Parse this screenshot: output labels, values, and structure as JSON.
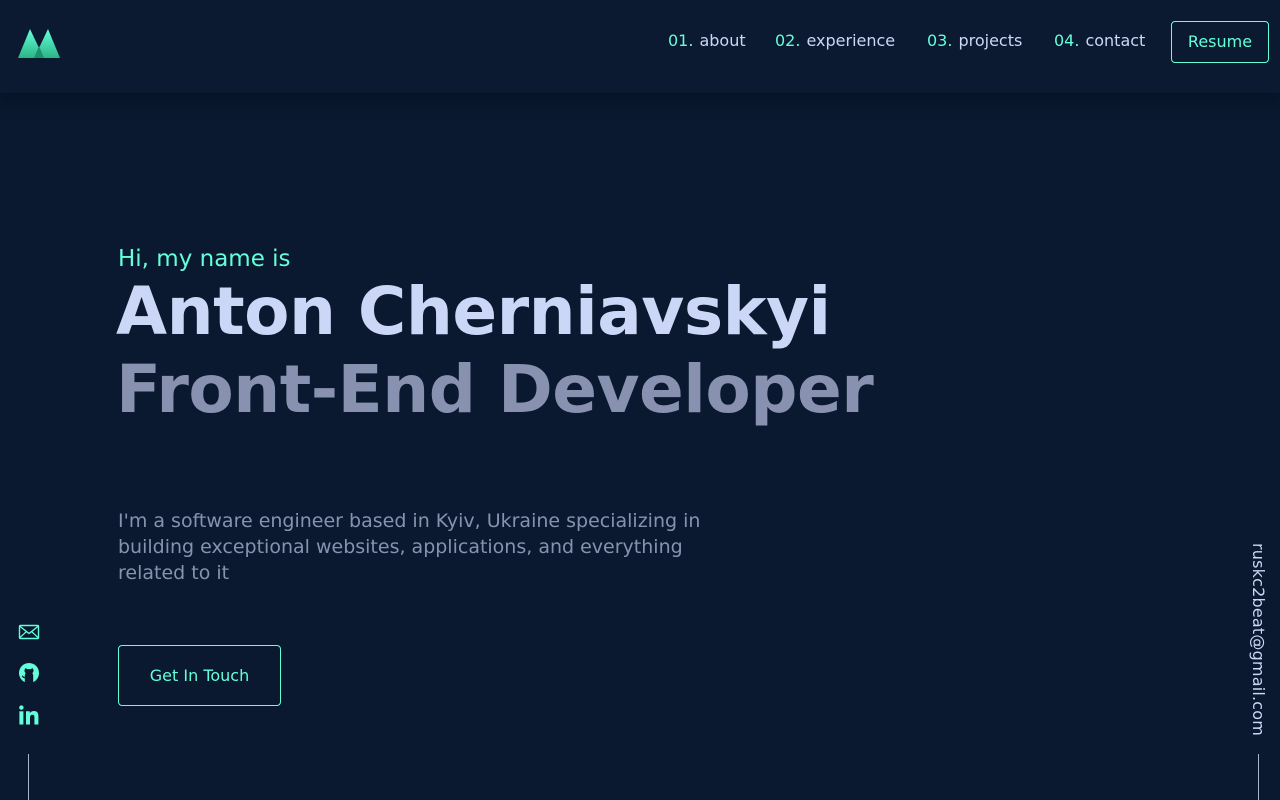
{
  "colors": {
    "background": "#0a192f",
    "header": "#0b1a30",
    "accent": "#64ffda",
    "heading": "#ccd6f6",
    "muted": "#8892b0"
  },
  "logo": {
    "icon": "m-mountain-logo-icon"
  },
  "nav": {
    "items": [
      {
        "num": "01.",
        "label": "about"
      },
      {
        "num": "02.",
        "label": "experience"
      },
      {
        "num": "03.",
        "label": "projects"
      },
      {
        "num": "04.",
        "label": "contact"
      }
    ],
    "resume_label": "Resume"
  },
  "hero": {
    "greeting": "Hi, my name is",
    "name": "Anton Cherniavskyi",
    "role": "Front-End Developer",
    "bio": "I'm a software engineer based in Kyiv, Ukraine specializing in building exceptional websites, applications, and everything related to it",
    "cta_label": "Get In Touch"
  },
  "social": {
    "icons": [
      "mail-icon",
      "github-icon",
      "linkedin-icon"
    ]
  },
  "side_email": "ruskc2beat@gmail.com"
}
